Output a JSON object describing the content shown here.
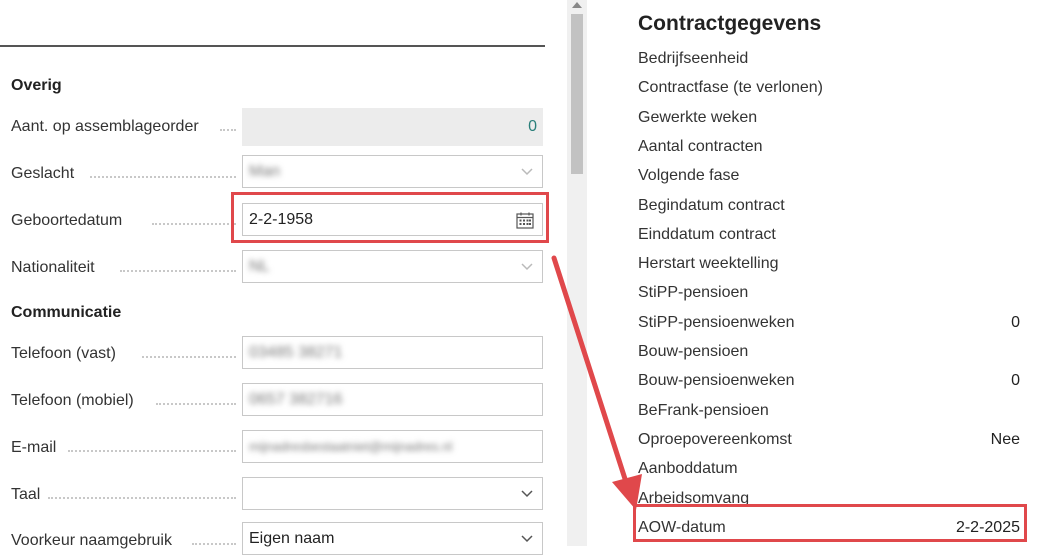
{
  "overig": {
    "title": "Overig",
    "assembly_label": "Aant. op assemblageorder",
    "assembly_value": "0",
    "gender_label": "Geslacht",
    "gender_value": "Man",
    "birthdate_label": "Geboortedatum",
    "birthdate_value": "2-2-1958",
    "nationality_label": "Nationaliteit",
    "nationality_value": "NL"
  },
  "communicatie": {
    "title": "Communicatie",
    "phone_label": "Telefoon (vast)",
    "phone_value": "03485 38271",
    "mobile_label": "Telefoon (mobiel)",
    "mobile_value": "0657 382716",
    "email_label": "E-mail",
    "email_value": "mijnadresbestaatniet@mijnadres.nl",
    "language_label": "Taal",
    "language_value": "",
    "name_pref_label": "Voorkeur naamgebruik",
    "name_pref_value": "Eigen naam"
  },
  "contract": {
    "title": "Contractgegevens",
    "rows": [
      {
        "label": "Bedrijfseenheid",
        "value": ""
      },
      {
        "label": "Contractfase (te verlonen)",
        "value": ""
      },
      {
        "label": "Gewerkte weken",
        "value": ""
      },
      {
        "label": "Aantal contracten",
        "value": ""
      },
      {
        "label": "Volgende fase",
        "value": ""
      },
      {
        "label": "Begindatum contract",
        "value": ""
      },
      {
        "label": "Einddatum contract",
        "value": ""
      },
      {
        "label": "Herstart weektelling",
        "value": ""
      },
      {
        "label": "StiPP-pensioen",
        "value": ""
      },
      {
        "label": "StiPP-pensioenweken",
        "value": "0"
      },
      {
        "label": "Bouw-pensioen",
        "value": ""
      },
      {
        "label": "Bouw-pensioenweken",
        "value": "0"
      },
      {
        "label": "BeFrank-pensioen",
        "value": ""
      },
      {
        "label": "Oproepovereenkomst",
        "value": "Nee"
      },
      {
        "label": "Aanboddatum",
        "value": ""
      },
      {
        "label": "Arbeidsomvang",
        "value": ""
      },
      {
        "label": "AOW-datum",
        "value": "2-2-2025"
      }
    ]
  },
  "colors": {
    "highlight": "#e0484b",
    "arrow": "#e0484b",
    "accent_value": "#2a7f7a"
  }
}
